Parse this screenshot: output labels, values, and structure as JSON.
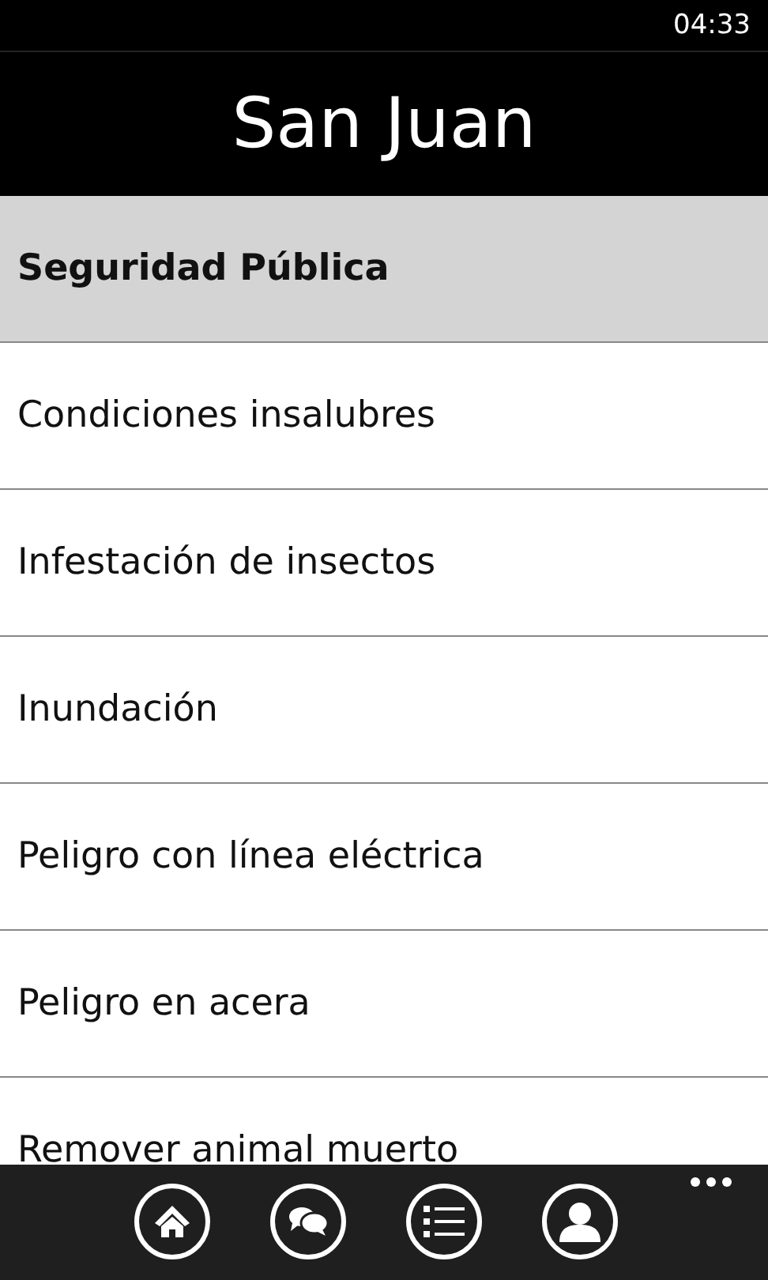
{
  "status_bar": {
    "time": "04:33"
  },
  "header": {
    "title": "San Juan"
  },
  "items": [
    {
      "label": "Seguridad Pública",
      "selected": true
    },
    {
      "label": "Condiciones insalubres",
      "selected": false
    },
    {
      "label": "Infestación de insectos",
      "selected": false
    },
    {
      "label": "Inundación",
      "selected": false
    },
    {
      "label": "Peligro con línea eléctrica",
      "selected": false
    },
    {
      "label": "Peligro en acera",
      "selected": false
    },
    {
      "label": "Remover animal muerto",
      "selected": false
    }
  ],
  "app_bar": {
    "buttons": [
      {
        "kind": "home"
      },
      {
        "kind": "chat"
      },
      {
        "kind": "list"
      },
      {
        "kind": "person"
      }
    ]
  }
}
